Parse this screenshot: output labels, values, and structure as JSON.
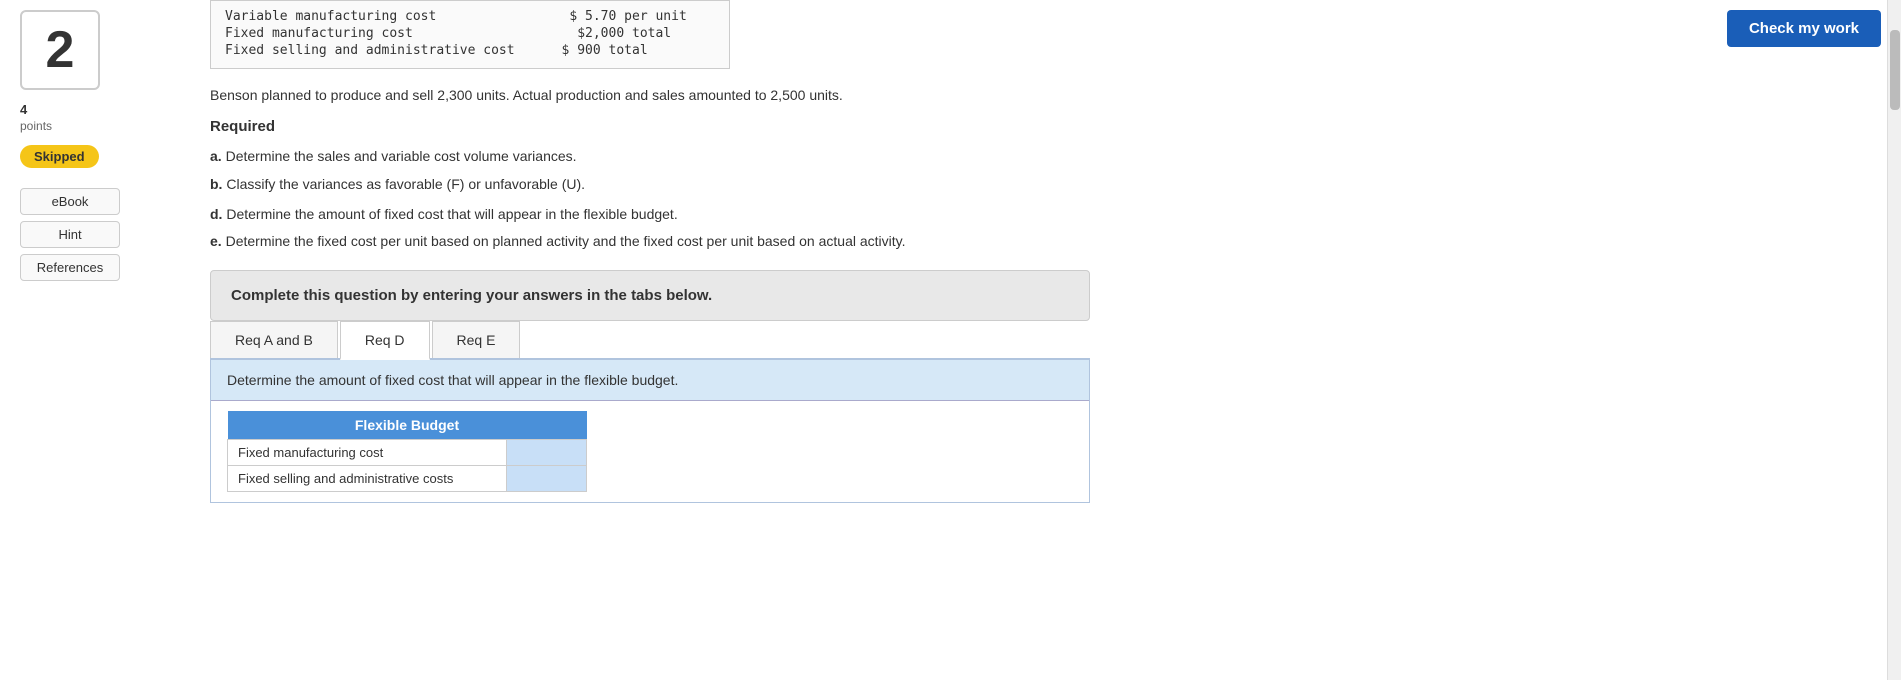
{
  "question_number": "2",
  "points": {
    "value": "4",
    "label": "points"
  },
  "skipped_badge": "Skipped",
  "sidebar_buttons": [
    {
      "label": "eBook",
      "name": "ebook-button"
    },
    {
      "label": "Hint",
      "name": "hint-button"
    },
    {
      "label": "References",
      "name": "references-button"
    }
  ],
  "cost_table": {
    "rows": [
      {
        "label": "Variable manufacturing cost",
        "value": "$ 5.70 per unit"
      },
      {
        "label": "Fixed manufacturing cost",
        "value": "$2,000 total"
      },
      {
        "label": "Fixed selling and administrative cost",
        "value": "$  900 total"
      }
    ]
  },
  "intro_text": "Benson planned to produce and sell 2,300 units. Actual production and sales amounted to 2,500 units.",
  "required_heading": "Required",
  "requirements": [
    {
      "prefix": "a.",
      "text": "Determine the sales and variable cost volume variances."
    },
    {
      "prefix": "b.",
      "text": "Classify the variances as favorable (F) or unfavorable (U)."
    },
    {
      "prefix": "d.",
      "text": "Determine the amount of fixed cost that will appear in the flexible budget."
    },
    {
      "prefix": "e.",
      "text": "Determine the fixed cost per unit based on planned activity and the fixed cost per unit based on actual activity."
    }
  ],
  "complete_box_text": "Complete this question by entering your answers in the tabs below.",
  "tabs": [
    {
      "label": "Req A and B",
      "name": "tab-req-ab",
      "active": false
    },
    {
      "label": "Req D",
      "name": "tab-req-d",
      "active": true
    },
    {
      "label": "Req E",
      "name": "tab-req-e",
      "active": false
    }
  ],
  "active_tab": {
    "description": "Determine the amount of fixed cost that will appear in the flexible budget.",
    "table": {
      "header": "Flexible Budget",
      "rows": [
        {
          "label": "Fixed manufacturing cost",
          "value": ""
        },
        {
          "label": "Fixed selling and administrative costs",
          "value": ""
        }
      ]
    }
  },
  "check_my_work_button": "Check my work"
}
